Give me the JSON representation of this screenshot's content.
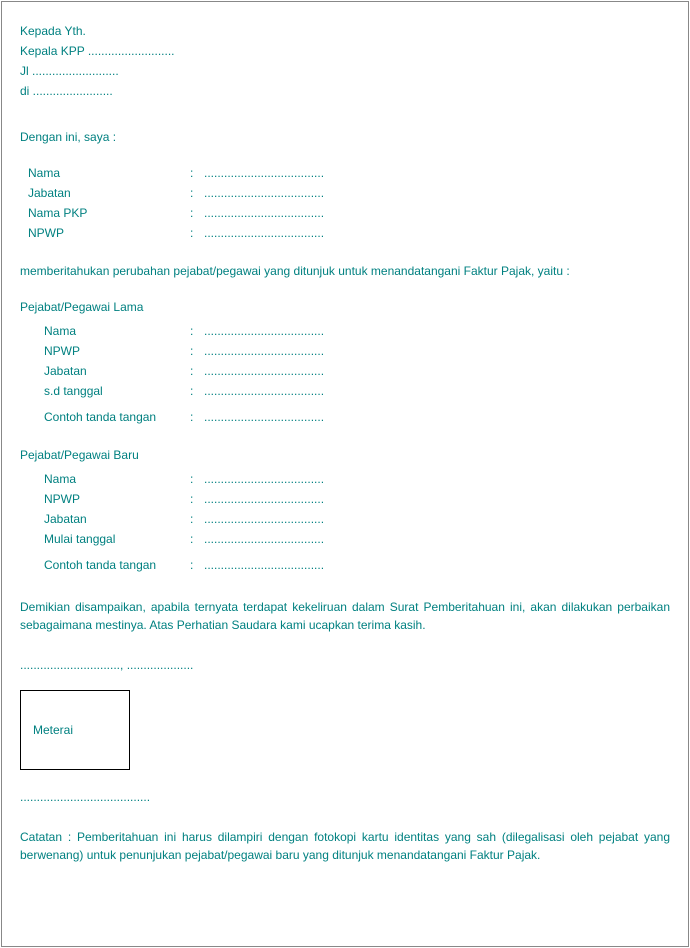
{
  "dots_long": "....................................",
  "dots_med": "............................",
  "dots_short": "...........................",
  "dots_tiny": ".......................",
  "dots_city": "..................",
  "header": {
    "kepada": "Kepada Yth.",
    "kepala": "Kepala KPP ..........................",
    "jl": "Jl ..........................",
    "di": "di ........................"
  },
  "intro": "Dengan ini, saya :",
  "fields": {
    "nama": "Nama",
    "jabatan": "Jabatan",
    "nama_pkp": "Nama PKP",
    "npwp": "NPWP"
  },
  "notify_sentence": "memberitahukan perubahan pejabat/pegawai yang ditunjuk untuk menandatangani Faktur Pajak, yaitu :",
  "old_section": "Pejabat/Pegawai Lama",
  "old": {
    "nama": "Nama",
    "npwp": "NPWP",
    "jabatan": "Jabatan",
    "sd": "s.d tanggal",
    "ttd": "Contoh tanda tangan"
  },
  "new_section": "Pejabat/Pegawai Baru",
  "new": {
    "nama": "Nama",
    "npwp": "NPWP",
    "jabatan": "Jabatan",
    "mulai": "Mulai tanggal",
    "ttd": "Contoh tanda tangan"
  },
  "closing": "Demikian disampaikan, apabila ternyata terdapat kekeliruan dalam Surat Pemberitahuan ini, akan dilakukan perbaikan sebagaimana mestinya. Atas Perhatian Saudara kami ucapkan terima kasih.",
  "date_line": ".............................., ....................",
  "meterai": "Meterai",
  "sig_dots": ".......................................",
  "catatan": "Catatan : Pemberitahuan ini harus dilampiri dengan fotokopi kartu identitas yang sah (dilegalisasi oleh pejabat yang berwenang) untuk penunjukan pejabat/pegawai baru yang ditunjuk menandatangani Faktur Pajak."
}
